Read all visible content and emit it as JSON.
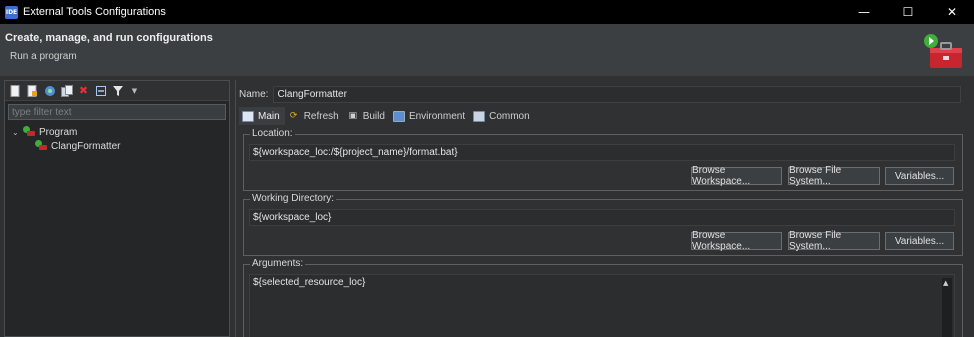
{
  "window": {
    "title": "External Tools Configurations",
    "icon_text": "IDE",
    "controls": [
      "minimize-icon",
      "maximize-icon",
      "close-icon"
    ]
  },
  "banner": {
    "title": "Create, manage, and run configurations",
    "subtitle": "Run a program"
  },
  "left": {
    "toolbar_icons": [
      "new-config-icon",
      "new-prototype-icon",
      "duplicate-icon",
      "export-icon",
      "delete-icon",
      "collapse-all-icon",
      "filter-icon",
      "dropdown-icon"
    ],
    "filter_placeholder": "type filter text",
    "tree": {
      "root_label": "Program",
      "child_label": "ClangFormatter"
    }
  },
  "right": {
    "name_label": "Name:",
    "name_value": "ClangFormatter",
    "tabs": [
      {
        "label": "Main",
        "icon": "main-tab-icon"
      },
      {
        "label": "Refresh",
        "icon": "refresh-icon"
      },
      {
        "label": "Build",
        "icon": "build-icon"
      },
      {
        "label": "Environment",
        "icon": "environment-icon"
      },
      {
        "label": "Common",
        "icon": "common-icon"
      }
    ],
    "location": {
      "label": "Location:",
      "value": "${workspace_loc:/${project_name}/format.bat}",
      "browse_workspace": "Browse Workspace...",
      "browse_fs": "Browse File System...",
      "variables": "Variables..."
    },
    "working_dir": {
      "label": "Working Directory:",
      "value": "${workspace_loc}",
      "browse_workspace": "Browse Workspace...",
      "browse_fs": "Browse File System...",
      "variables": "Variables..."
    },
    "arguments": {
      "label": "Arguments:",
      "value": "${selected_resource_loc}"
    }
  },
  "colors": {
    "background": "#2f3133",
    "titlebar": "#000000",
    "banner": "#3c3f41",
    "accent_green": "#3fae3a",
    "accent_red": "#c8262f"
  }
}
